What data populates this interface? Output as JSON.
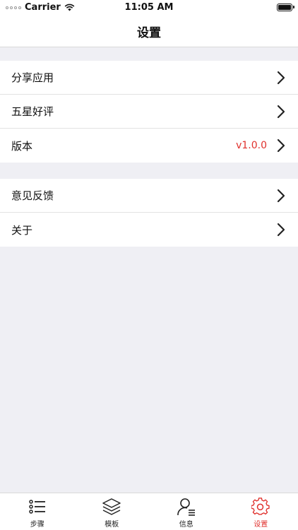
{
  "status_bar": {
    "carrier": "Carrier",
    "time": "11:05 AM"
  },
  "nav": {
    "title": "设置"
  },
  "groups": [
    {
      "items": [
        {
          "label": "分享应用"
        },
        {
          "label": "五星好评"
        },
        {
          "label": "版本",
          "value": "v1.0.0"
        }
      ]
    },
    {
      "items": [
        {
          "label": "意见反馈"
        },
        {
          "label": "关于"
        }
      ]
    }
  ],
  "tab_bar": {
    "tabs": [
      {
        "label": "步骤",
        "icon": "list-icon"
      },
      {
        "label": "模板",
        "icon": "layers-icon"
      },
      {
        "label": "信息",
        "icon": "user-info-icon"
      },
      {
        "label": "设置",
        "icon": "gear-icon",
        "active": true
      }
    ]
  },
  "colors": {
    "accent": "#e0302c",
    "background": "#efeff4"
  }
}
